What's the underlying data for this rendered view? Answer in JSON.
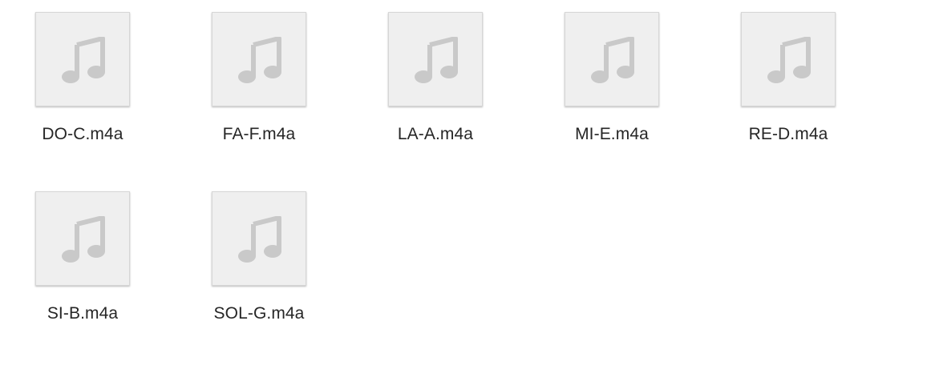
{
  "files": [
    {
      "name": "DO-C.m4a",
      "icon": "music-note-icon"
    },
    {
      "name": "FA-F.m4a",
      "icon": "music-note-icon"
    },
    {
      "name": "LA-A.m4a",
      "icon": "music-note-icon"
    },
    {
      "name": "MI-E.m4a",
      "icon": "music-note-icon"
    },
    {
      "name": "RE-D.m4a",
      "icon": "music-note-icon"
    },
    {
      "name": "SI-B.m4a",
      "icon": "music-note-icon"
    },
    {
      "name": "SOL-G.m4a",
      "icon": "music-note-icon"
    }
  ],
  "colors": {
    "thumbnail_background": "#efefef",
    "note_icon": "#c9c9c9",
    "label_text": "#262626"
  }
}
